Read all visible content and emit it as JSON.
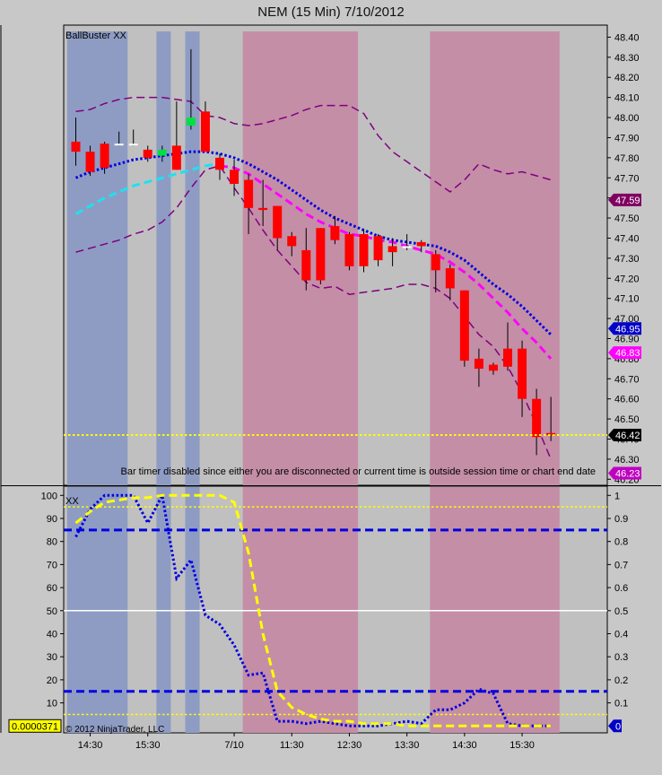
{
  "title": "NEM (15 Min)  7/10/2012",
  "colors": {
    "background": "#c0c0c0",
    "session_blue": "#8e9cc4",
    "session_pink": "#c48ea6",
    "up_candle": "#00e040",
    "down_candle": "#ff0000",
    "doji_candle": "#ffffff",
    "band_purple": "#800080",
    "blue_ma": "#0000e0",
    "magenta_ma": "#ff00ff",
    "cyan_ma": "#20e0f0",
    "yellow_line": "#ffff00"
  },
  "chart_data": [
    {
      "type": "candlestick",
      "panel_label": "BallBuster XX",
      "ylim": [
        46.17,
        48.46
      ],
      "yticks": [
        "48.40",
        "48.30",
        "48.20",
        "48.10",
        "48.00",
        "47.90",
        "47.80",
        "47.70",
        "47.60",
        "47.50",
        "47.40",
        "47.30",
        "47.20",
        "47.10",
        "47.00",
        "46.90",
        "46.80",
        "46.70",
        "46.60",
        "46.50",
        "46.40",
        "46.30",
        "46.20"
      ],
      "x_labels": [
        {
          "i": 1,
          "label": "14:30"
        },
        {
          "i": 5,
          "label": "15:30"
        },
        {
          "i": 11,
          "label": "7/10"
        },
        {
          "i": 15,
          "label": "11:30"
        },
        {
          "i": 19,
          "label": "12:30"
        },
        {
          "i": 23,
          "label": "13:30"
        },
        {
          "i": 27,
          "label": "14:30"
        },
        {
          "i": 31,
          "label": "15:30"
        }
      ],
      "shaded_sessions": [
        {
          "color": "blue",
          "from": -0.6,
          "to": 3.6
        },
        {
          "color": "blue",
          "from": 5.6,
          "to": 6.6
        },
        {
          "color": "blue",
          "from": 7.6,
          "to": 8.6
        },
        {
          "color": "pink",
          "from": 11.6,
          "to": 19.6
        },
        {
          "color": "pink",
          "from": 24.6,
          "to": 33.6
        }
      ],
      "candles": [
        {
          "o": 47.88,
          "h": 48.0,
          "l": 47.76,
          "c": 47.83
        },
        {
          "o": 47.83,
          "h": 47.86,
          "l": 47.71,
          "c": 47.73
        },
        {
          "o": 47.87,
          "h": 47.88,
          "l": 47.72,
          "c": 47.75
        },
        {
          "o": 47.87,
          "h": 47.93,
          "l": 47.86,
          "c": 47.87
        },
        {
          "o": 47.87,
          "h": 47.94,
          "l": 47.86,
          "c": 47.87
        },
        {
          "o": 47.84,
          "h": 47.86,
          "l": 47.78,
          "c": 47.8
        },
        {
          "o": 47.81,
          "h": 47.86,
          "l": 47.78,
          "c": 47.84
        },
        {
          "o": 47.86,
          "h": 48.08,
          "l": 47.74,
          "c": 47.74
        },
        {
          "o": 47.96,
          "h": 48.34,
          "l": 47.94,
          "c": 48.0
        },
        {
          "o": 48.03,
          "h": 48.08,
          "l": 47.83,
          "c": 47.83
        },
        {
          "o": 47.8,
          "h": 47.82,
          "l": 47.69,
          "c": 47.74
        },
        {
          "o": 47.74,
          "h": 47.79,
          "l": 47.61,
          "c": 47.67
        },
        {
          "o": 47.69,
          "h": 47.72,
          "l": 47.42,
          "c": 47.55
        },
        {
          "o": 47.55,
          "h": 47.69,
          "l": 47.46,
          "c": 47.54
        },
        {
          "o": 47.56,
          "h": 47.56,
          "l": 47.34,
          "c": 47.4
        },
        {
          "o": 47.41,
          "h": 47.43,
          "l": 47.31,
          "c": 47.36
        },
        {
          "o": 47.34,
          "h": 47.45,
          "l": 47.14,
          "c": 47.19
        },
        {
          "o": 47.45,
          "h": 47.45,
          "l": 47.17,
          "c": 47.19
        },
        {
          "o": 47.46,
          "h": 47.51,
          "l": 47.37,
          "c": 47.39
        },
        {
          "o": 47.42,
          "h": 47.43,
          "l": 47.24,
          "c": 47.26
        },
        {
          "o": 47.42,
          "h": 47.44,
          "l": 47.23,
          "c": 47.26
        },
        {
          "o": 47.41,
          "h": 47.42,
          "l": 47.26,
          "c": 47.29
        },
        {
          "o": 47.36,
          "h": 47.4,
          "l": 47.26,
          "c": 47.33
        },
        {
          "o": 47.36,
          "h": 47.42,
          "l": 47.34,
          "c": 47.36
        },
        {
          "o": 47.38,
          "h": 47.39,
          "l": 47.33,
          "c": 47.36
        },
        {
          "o": 47.32,
          "h": 47.34,
          "l": 47.13,
          "c": 47.24
        },
        {
          "o": 47.25,
          "h": 47.27,
          "l": 47.09,
          "c": 47.15
        },
        {
          "o": 47.14,
          "h": 47.14,
          "l": 46.76,
          "c": 46.79
        },
        {
          "o": 46.8,
          "h": 46.85,
          "l": 46.66,
          "c": 46.75
        },
        {
          "o": 46.77,
          "h": 46.78,
          "l": 46.72,
          "c": 46.74
        },
        {
          "o": 46.85,
          "h": 46.98,
          "l": 46.74,
          "c": 46.76
        },
        {
          "o": 46.85,
          "h": 46.89,
          "l": 46.51,
          "c": 46.6
        },
        {
          "o": 46.6,
          "h": 46.65,
          "l": 46.32,
          "c": 46.41
        },
        {
          "o": 46.43,
          "h": 46.61,
          "l": 46.39,
          "c": 46.42
        }
      ],
      "series": [
        {
          "style": "dashed",
          "color": "purple",
          "values": [
            48.03,
            48.04,
            48.07,
            48.09,
            48.1,
            48.1,
            48.1,
            48.09,
            48.08,
            48.01,
            48.0,
            47.97,
            47.96,
            47.97,
            47.99,
            48.01,
            48.04,
            48.06,
            48.06,
            48.06,
            48.02,
            47.91,
            47.83,
            47.78,
            47.73,
            47.68,
            47.63,
            47.69,
            47.77,
            47.74,
            47.72,
            47.73,
            47.71,
            47.69
          ]
        },
        {
          "style": "dashed",
          "color": "purple",
          "values": [
            47.33,
            47.35,
            47.37,
            47.39,
            47.42,
            47.44,
            47.48,
            47.55,
            47.65,
            47.74,
            47.76,
            47.65,
            47.55,
            47.44,
            47.34,
            47.26,
            47.18,
            47.15,
            47.16,
            47.12,
            47.13,
            47.14,
            47.15,
            47.17,
            47.17,
            47.15,
            47.1,
            47.01,
            46.92,
            46.86,
            46.76,
            46.63,
            46.47,
            46.3
          ]
        },
        {
          "style": "dotted",
          "color": "blue",
          "values": [
            47.7,
            47.73,
            47.75,
            47.77,
            47.79,
            47.8,
            47.81,
            47.82,
            47.83,
            47.83,
            47.82,
            47.8,
            47.77,
            47.73,
            47.69,
            47.64,
            47.59,
            47.54,
            47.5,
            47.47,
            47.44,
            47.41,
            47.39,
            47.38,
            47.37,
            47.36,
            47.33,
            47.29,
            47.23,
            47.17,
            47.12,
            47.06,
            46.99,
            46.92
          ]
        },
        {
          "style": "dashed",
          "color": "magenta",
          "values": [
            null,
            null,
            null,
            null,
            null,
            null,
            null,
            null,
            null,
            null,
            47.76,
            47.75,
            47.72,
            47.67,
            47.62,
            47.57,
            47.52,
            47.48,
            47.45,
            47.42,
            47.41,
            47.39,
            47.38,
            47.36,
            47.34,
            47.32,
            47.28,
            47.23,
            47.17,
            47.1,
            47.03,
            46.95,
            46.88,
            46.8
          ]
        },
        {
          "style": "dashed",
          "color": "cyan",
          "values": [
            47.52,
            47.56,
            47.6,
            47.63,
            47.66,
            47.68,
            47.7,
            47.72,
            47.74,
            47.76,
            47.77,
            null,
            null,
            null,
            null,
            null,
            null,
            null,
            null,
            null,
            null,
            null,
            null,
            null,
            null,
            null,
            null,
            null,
            null,
            null,
            null,
            null,
            null,
            null
          ]
        }
      ],
      "hlines": [
        {
          "value": 46.42,
          "style": "dotted",
          "color": "yellow"
        }
      ],
      "price_badges": [
        {
          "value": 47.59,
          "label": "47.59",
          "bg": "#800060",
          "fg": "#ffffff"
        },
        {
          "value": 46.95,
          "label": "46.95",
          "bg": "#0000c8",
          "fg": "#ffffff"
        },
        {
          "value": 46.83,
          "label": "46.83",
          "bg": "#ff00ff",
          "fg": "#ffffff"
        },
        {
          "value": 46.42,
          "label": "46.42",
          "bg": "#000000",
          "fg": "#ffffff"
        },
        {
          "value": 46.23,
          "label": "46.23",
          "bg": "#c000c0",
          "fg": "#ffffff"
        }
      ],
      "annotation": "Bar timer disabled since either you are disconnected or current time is outside session time or chart end date"
    },
    {
      "type": "line",
      "panel_label": "XX",
      "left_ylim": [
        -3,
        104
      ],
      "right_ylim": [
        -0.03,
        1.04
      ],
      "left_ticks": [
        "100",
        "90",
        "80",
        "70",
        "60",
        "50",
        "40",
        "30",
        "20",
        "10"
      ],
      "right_ticks": [
        "1",
        "0.9",
        "0.8",
        "0.7",
        "0.6",
        "0.5",
        "0.4",
        "0.3",
        "0.2",
        "0.1"
      ],
      "hlines": [
        {
          "value": 85,
          "style": "dashed",
          "color": "blue"
        },
        {
          "value": 15,
          "style": "dashed",
          "color": "blue"
        },
        {
          "value": 50,
          "style": "solid",
          "color": "white"
        },
        {
          "value": 95,
          "style": "dotted",
          "color": "yellow"
        },
        {
          "value": 5,
          "style": "dotted",
          "color": "yellow"
        }
      ],
      "series": [
        {
          "style": "dotted",
          "color": "blue",
          "values": [
            82,
            94,
            100,
            100,
            100,
            88,
            100,
            64,
            72,
            48,
            44,
            35,
            22,
            23,
            2,
            2,
            1,
            2,
            1,
            0,
            0,
            0,
            1,
            2,
            1,
            7,
            7,
            10,
            16,
            14,
            1,
            0,
            0,
            0
          ]
        },
        {
          "style": "dashed",
          "color": "yellow",
          "values": [
            88,
            93,
            97,
            98,
            99,
            99,
            100,
            100,
            100,
            100,
            100,
            97,
            75,
            40,
            15,
            8,
            5,
            3,
            2,
            2,
            1,
            1,
            1,
            0,
            0,
            0,
            0,
            0,
            0,
            0,
            0,
            0,
            0,
            0
          ]
        }
      ],
      "left_badge": "0.0000371",
      "right_badge": "0",
      "copyright": "© 2012 NinjaTrader, LLC"
    }
  ]
}
